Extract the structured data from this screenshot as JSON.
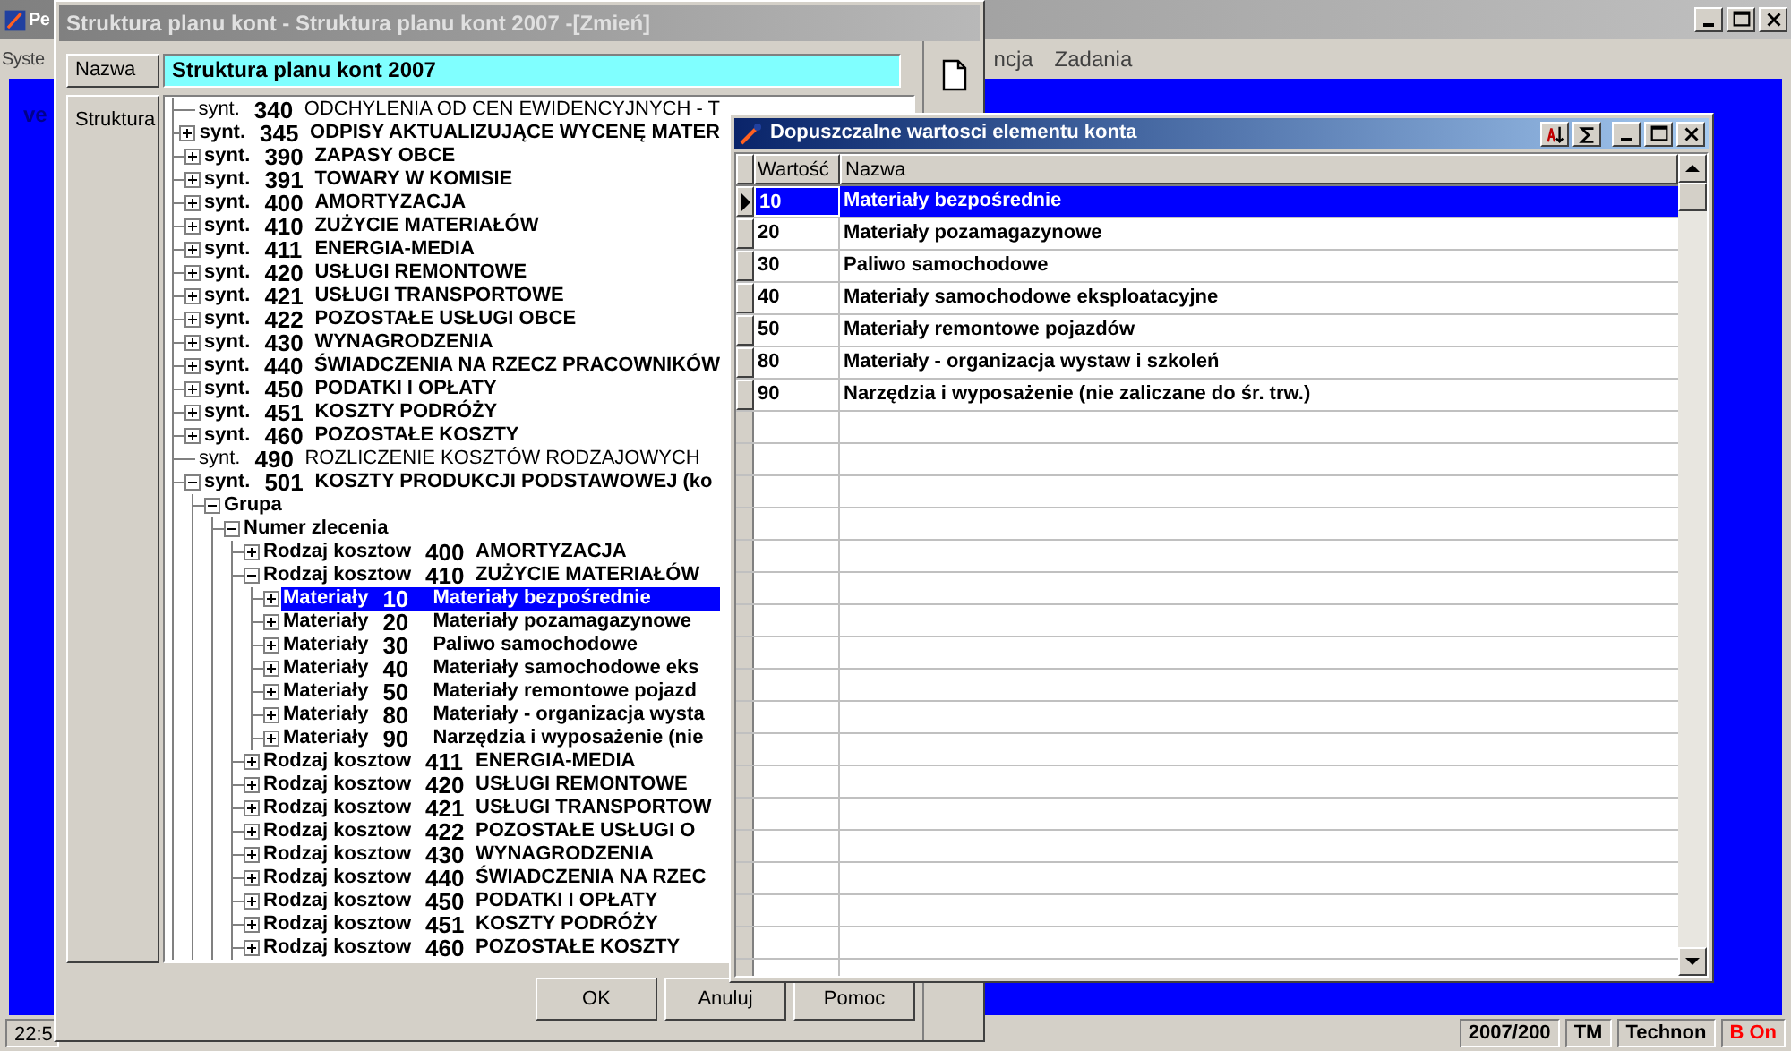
{
  "app": {
    "title": "Pe",
    "menu_left": [
      "Syste"
    ],
    "menu_right": [
      "ncja",
      "Zadania"
    ],
    "workspace_text": "ve",
    "status_bar": {
      "time": "22:5",
      "fields": [
        {
          "text": "2007/200",
          "color": "#000000"
        },
        {
          "text": "TM",
          "color": "#000000"
        },
        {
          "text": "Technon",
          "color": "#000000"
        },
        {
          "text": "B On",
          "color": "#ff0000"
        }
      ]
    }
  },
  "dialog": {
    "title": "Struktura planu kont - Struktura planu kont 2007 -[Zmień]",
    "name_label": "Nazwa",
    "name_value": "Struktura planu kont 2007",
    "structure_label": "Struktura",
    "tree": [
      {
        "kind": "leaf",
        "prefix": "synt.",
        "code": "340",
        "name": "ODCHYLENIA OD CEN EWIDENCYJNYCH - T",
        "bold": false,
        "selected": false
      },
      {
        "kind": "node",
        "prefix": "synt.",
        "code": "345",
        "name": "ODPISY AKTUALIZUJĄCE WYCENĘ MATER",
        "bold": true,
        "expanded": false,
        "selected": false
      },
      {
        "kind": "node",
        "prefix": "synt.",
        "code": "390",
        "name": "ZAPASY OBCE",
        "bold": true,
        "expanded": false,
        "selected": false
      },
      {
        "kind": "node",
        "prefix": "synt.",
        "code": "391",
        "name": "TOWARY W KOMISIE",
        "bold": true,
        "expanded": false,
        "selected": false
      },
      {
        "kind": "node",
        "prefix": "synt.",
        "code": "400",
        "name": "AMORTYZACJA",
        "bold": true,
        "expanded": false,
        "selected": false
      },
      {
        "kind": "node",
        "prefix": "synt.",
        "code": "410",
        "name": "ZUŻYCIE MATERIAŁÓW",
        "bold": true,
        "expanded": false,
        "selected": false
      },
      {
        "kind": "node",
        "prefix": "synt.",
        "code": "411",
        "name": "ENERGIA-MEDIA",
        "bold": true,
        "expanded": false,
        "selected": false
      },
      {
        "kind": "node",
        "prefix": "synt.",
        "code": "420",
        "name": "USŁUGI REMONTOWE",
        "bold": true,
        "expanded": false,
        "selected": false
      },
      {
        "kind": "node",
        "prefix": "synt.",
        "code": "421",
        "name": "USŁUGI TRANSPORTOWE",
        "bold": true,
        "expanded": false,
        "selected": false
      },
      {
        "kind": "node",
        "prefix": "synt.",
        "code": "422",
        "name": "POZOSTAŁE USŁUGI OBCE",
        "bold": true,
        "expanded": false,
        "selected": false
      },
      {
        "kind": "node",
        "prefix": "synt.",
        "code": "430",
        "name": "WYNAGRODZENIA",
        "bold": true,
        "expanded": false,
        "selected": false
      },
      {
        "kind": "node",
        "prefix": "synt.",
        "code": "440",
        "name": "ŚWIADCZENIA NA RZECZ PRACOWNIKÓW",
        "bold": true,
        "expanded": false,
        "selected": false
      },
      {
        "kind": "node",
        "prefix": "synt.",
        "code": "450",
        "name": "PODATKI I OPŁATY",
        "bold": true,
        "expanded": false,
        "selected": false
      },
      {
        "kind": "node",
        "prefix": "synt.",
        "code": "451",
        "name": "KOSZTY PODRÓŻY",
        "bold": true,
        "expanded": false,
        "selected": false
      },
      {
        "kind": "node",
        "prefix": "synt.",
        "code": "460",
        "name": "POZOSTAŁE KOSZTY",
        "bold": true,
        "expanded": false,
        "selected": false
      },
      {
        "kind": "leaf",
        "prefix": "synt.",
        "code": "490",
        "name": "ROZLICZENIE KOSZTÓW RODZAJOWYCH",
        "bold": false,
        "selected": false
      },
      {
        "kind": "node",
        "prefix": "synt.",
        "code": "501",
        "name": "KOSZTY PRODUKCJI PODSTAWOWEJ (ko",
        "bold": true,
        "expanded": true,
        "selected": false,
        "children": [
          {
            "kind": "node",
            "prefix": "Grupa",
            "bold": true,
            "expanded": true,
            "selected": false,
            "children": [
              {
                "kind": "node",
                "prefix": "Numer zlecenia",
                "bold": true,
                "expanded": true,
                "selected": false,
                "children": [
                  {
                    "kind": "node",
                    "prefix": "Rodzaj kosztow",
                    "code": "400",
                    "name": "AMORTYZACJA",
                    "bold": true,
                    "expanded": false,
                    "selected": false
                  },
                  {
                    "kind": "node",
                    "prefix": "Rodzaj kosztow",
                    "code": "410",
                    "name": "ZUŻYCIE MATERIAŁÓW",
                    "bold": true,
                    "expanded": true,
                    "selected": false,
                    "children": [
                      {
                        "kind": "node",
                        "prefix": "Materiały",
                        "code": "10",
                        "name": "Materiały bezpośrednie",
                        "bold": true,
                        "expanded": false,
                        "selected": true
                      },
                      {
                        "kind": "node",
                        "prefix": "Materiały",
                        "code": "20",
                        "name": "Materiały pozamagazynowe",
                        "bold": true,
                        "expanded": false,
                        "selected": false
                      },
                      {
                        "kind": "node",
                        "prefix": "Materiały",
                        "code": "30",
                        "name": "Paliwo samochodowe",
                        "bold": true,
                        "expanded": false,
                        "selected": false
                      },
                      {
                        "kind": "node",
                        "prefix": "Materiały",
                        "code": "40",
                        "name": "Materiały samochodowe eks",
                        "bold": true,
                        "expanded": false,
                        "selected": false
                      },
                      {
                        "kind": "node",
                        "prefix": "Materiały",
                        "code": "50",
                        "name": "Materiały remontowe pojazd",
                        "bold": true,
                        "expanded": false,
                        "selected": false
                      },
                      {
                        "kind": "node",
                        "prefix": "Materiały",
                        "code": "80",
                        "name": "Materiały - organizacja wysta",
                        "bold": true,
                        "expanded": false,
                        "selected": false
                      },
                      {
                        "kind": "node",
                        "prefix": "Materiały",
                        "code": "90",
                        "name": "Narzędzia i wyposażenie (nie",
                        "bold": true,
                        "expanded": false,
                        "selected": false
                      }
                    ]
                  },
                  {
                    "kind": "node",
                    "prefix": "Rodzaj kosztow",
                    "code": "411",
                    "name": "ENERGIA-MEDIA",
                    "bold": true,
                    "expanded": false,
                    "selected": false
                  },
                  {
                    "kind": "node",
                    "prefix": "Rodzaj kosztow",
                    "code": "420",
                    "name": "USŁUGI REMONTOWE",
                    "bold": true,
                    "expanded": false,
                    "selected": false
                  },
                  {
                    "kind": "node",
                    "prefix": "Rodzaj kosztow",
                    "code": "421",
                    "name": "USŁUGI TRANSPORTOW",
                    "bold": true,
                    "expanded": false,
                    "selected": false
                  },
                  {
                    "kind": "node",
                    "prefix": "Rodzaj kosztow",
                    "code": "422",
                    "name": "POZOSTAŁE USŁUGI O",
                    "bold": true,
                    "expanded": false,
                    "selected": false
                  },
                  {
                    "kind": "node",
                    "prefix": "Rodzaj kosztow",
                    "code": "430",
                    "name": "WYNAGRODZENIA",
                    "bold": true,
                    "expanded": false,
                    "selected": false
                  },
                  {
                    "kind": "node",
                    "prefix": "Rodzaj kosztow",
                    "code": "440",
                    "name": "ŚWIADCZENIA NA RZEC",
                    "bold": true,
                    "expanded": false,
                    "selected": false
                  },
                  {
                    "kind": "node",
                    "prefix": "Rodzaj kosztow",
                    "code": "450",
                    "name": "PODATKI I OPŁATY",
                    "bold": true,
                    "expanded": false,
                    "selected": false
                  },
                  {
                    "kind": "node",
                    "prefix": "Rodzaj kosztow",
                    "code": "451",
                    "name": "KOSZTY PODRÓŻY",
                    "bold": true,
                    "expanded": false,
                    "selected": false
                  },
                  {
                    "kind": "node",
                    "prefix": "Rodzaj kosztow",
                    "code": "460",
                    "name": "POZOSTAŁE KOSZTY",
                    "bold": true,
                    "expanded": false,
                    "selected": false
                  }
                ]
              }
            ]
          }
        ]
      }
    ],
    "buttons": [
      "OK",
      "Anuluj",
      "Pomoc"
    ]
  },
  "values_window": {
    "title": "Dopuszczalne wartosci elementu konta",
    "columns": [
      "Wartość",
      "Nazwa"
    ],
    "rows": [
      {
        "value": "10",
        "name": "Materiały bezpośrednie",
        "selected": true
      },
      {
        "value": "20",
        "name": "Materiały pozamagazynowe",
        "selected": false
      },
      {
        "value": "30",
        "name": "Paliwo samochodowe",
        "selected": false
      },
      {
        "value": "40",
        "name": "Materiały samochodowe eksploatacyjne",
        "selected": false
      },
      {
        "value": "50",
        "name": "Materiały remontowe pojazdów",
        "selected": false
      },
      {
        "value": "80",
        "name": "Materiały - organizacja wystaw i szkoleń",
        "selected": false
      },
      {
        "value": "90",
        "name": "Narzędzia i wyposażenie (nie zaliczane do śr. trw.)",
        "selected": false
      }
    ]
  }
}
